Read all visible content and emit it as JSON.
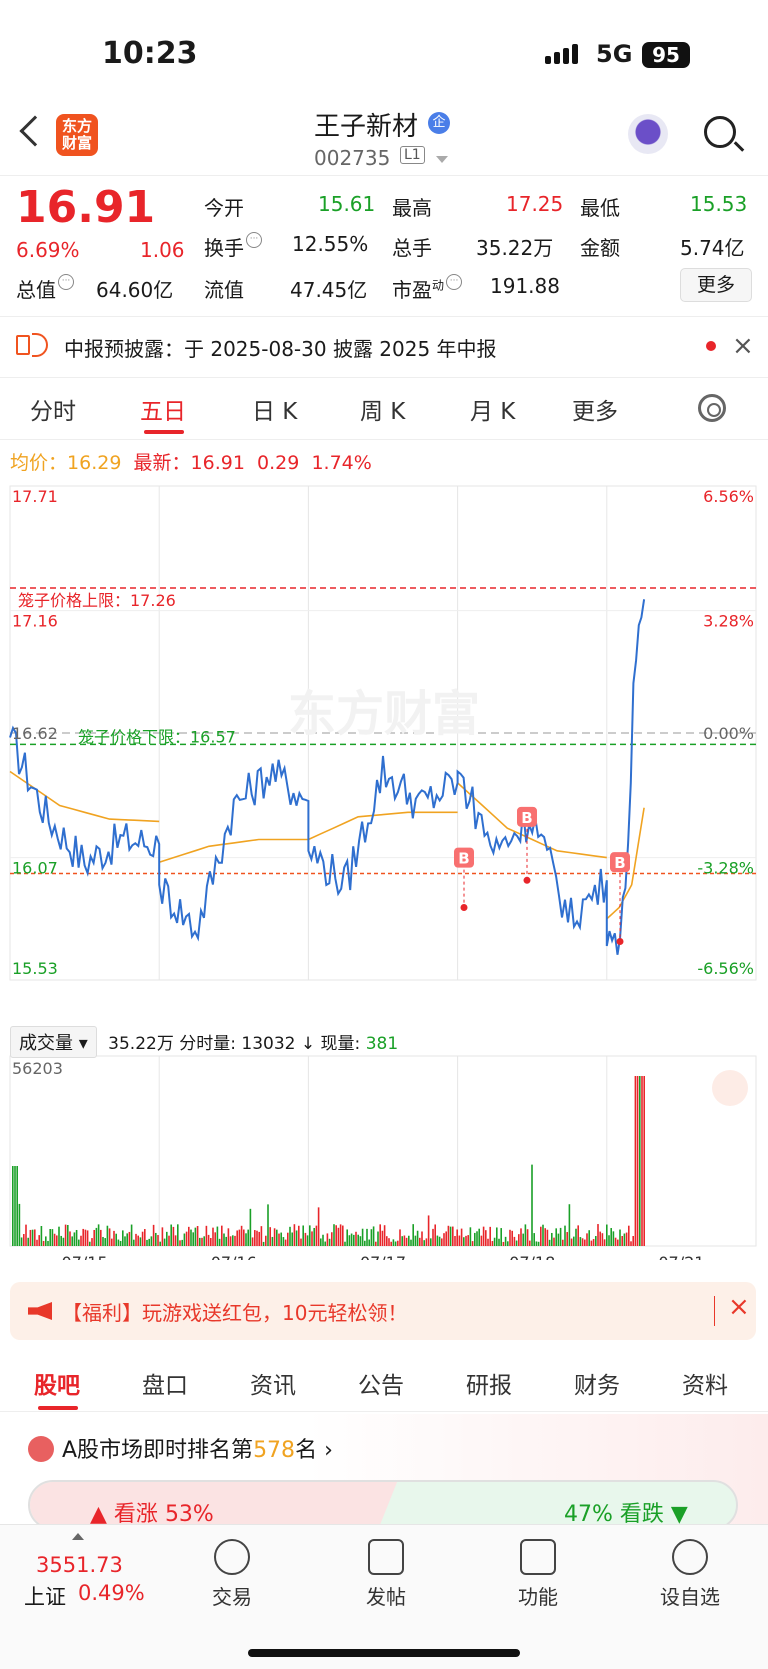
{
  "status": {
    "time": "10:23",
    "network": "5G",
    "battery": "95"
  },
  "header": {
    "logo": "东方财富",
    "name": "王子新材",
    "badge": "企",
    "code": "002735",
    "level": "L1"
  },
  "quote": {
    "price": "16.91",
    "change_pct": "6.69%",
    "change": "1.06",
    "open_label": "今开",
    "open": "15.61",
    "high_label": "最高",
    "high": "17.25",
    "low_label": "最低",
    "low": "15.53",
    "turnover_label": "换手",
    "turnover": "12.55%",
    "volume_label": "总手",
    "volume": "35.22万",
    "amount_label": "金额",
    "amount": "5.74亿",
    "mcap_label": "总值",
    "mcap": "64.60亿",
    "float_label": "流值",
    "float": "47.45亿",
    "pe_label": "市盈",
    "pe_sup": "动",
    "pe": "191.88",
    "more": "更多"
  },
  "notice": {
    "text": "中报预披露：于 2025-08-30 披露 2025 年中报",
    "close": "×"
  },
  "ktabs": [
    "分时",
    "五日",
    "日 K",
    "周 K",
    "月 K",
    "更多"
  ],
  "legend": {
    "avg_label": "均价：",
    "avg": "16.29",
    "last_label": "最新：",
    "last": "16.91",
    "chg": "0.29",
    "chg_pct": "1.74%"
  },
  "chart": {
    "y_left": [
      "17.71",
      "17.16",
      "16.62",
      "16.07",
      "15.53"
    ],
    "y_right": [
      "6.56%",
      "3.28%",
      "0.00%",
      "-3.28%",
      "-6.56%"
    ],
    "upper_limit_label": "笼子价格上限：17.26",
    "lower_limit_label": "笼子价格下限：16.57",
    "buy_marker": "B",
    "watermark": "东方财富",
    "dates": [
      "07/15",
      "07/16",
      "07/17",
      "07/18",
      "07/21"
    ]
  },
  "volume": {
    "select": "成交量",
    "total": "35.22万",
    "minute_label": "分时量:",
    "minute": "13032",
    "now_label": "现量:",
    "now": "381",
    "max": "56203"
  },
  "promo": {
    "text": "【福利】玩游戏送红包，10元轻松领！",
    "close": "×"
  },
  "btabs": [
    "股吧",
    "盘口",
    "资讯",
    "公告",
    "研报",
    "财务",
    "资料"
  ],
  "rank": {
    "prefix": "A股市场即时排名第",
    "num": "578",
    "suffix": "名",
    "up_label": "看涨",
    "up_pct": "53%",
    "down_pct": "47%",
    "down_label": "看跌"
  },
  "bottom": {
    "index_value": "3551.73",
    "index_name": "上证",
    "index_pct": "0.49%",
    "nav": [
      "交易",
      "发帖",
      "功能",
      "设自选"
    ]
  },
  "chart_data": {
    "type": "line",
    "x": [
      "07/15",
      "07/16",
      "07/17",
      "07/18",
      "07/21"
    ],
    "ylim": [
      15.53,
      17.71
    ],
    "reference_close": 16.62,
    "upper_limit": 17.26,
    "lower_limit": 16.57,
    "series": [
      {
        "name": "最新",
        "close_by_day": [
          16.13,
          16.32,
          16.4,
          15.97,
          17.21
        ]
      },
      {
        "name": "均价",
        "close_by_day": [
          16.23,
          16.15,
          16.27,
          16.07,
          16.29
        ]
      }
    ]
  }
}
